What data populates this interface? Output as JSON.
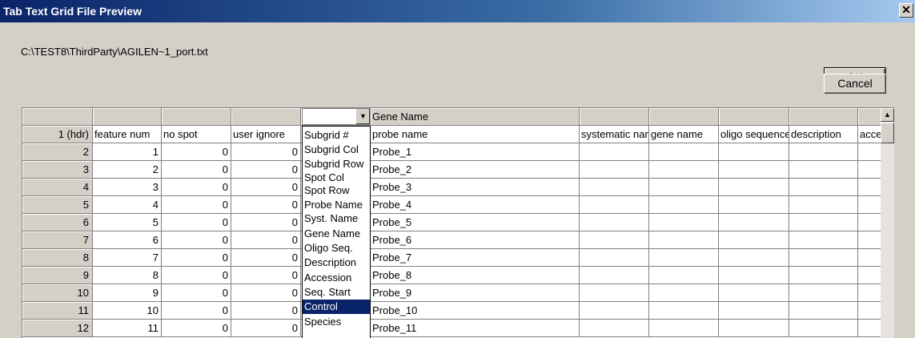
{
  "window": {
    "title": "Tab Text Grid File Preview",
    "close_glyph": "✕"
  },
  "file_path": "C:\\TEST8\\ThirdParty\\AGILEN~1_port.txt",
  "buttons": {
    "ok": "OK",
    "cancel": "Cancel"
  },
  "grid": {
    "mapping_row": [
      "",
      "",
      "",
      "",
      "",
      "Gene Name",
      "",
      "",
      "",
      "",
      ""
    ],
    "header_row": [
      "1 (hdr)",
      "feature num",
      "no spot",
      "user ignore",
      "",
      "probe name",
      "systematic name",
      "gene name",
      "oligo sequence",
      "description",
      "accession"
    ],
    "rows": [
      [
        "2",
        "1",
        "0",
        "0",
        "",
        "Probe_1"
      ],
      [
        "3",
        "2",
        "0",
        "0",
        "",
        "Probe_2"
      ],
      [
        "4",
        "3",
        "0",
        "0",
        "",
        "Probe_3"
      ],
      [
        "5",
        "4",
        "0",
        "0",
        "",
        "Probe_4"
      ],
      [
        "6",
        "5",
        "0",
        "0",
        "",
        "Probe_5"
      ],
      [
        "7",
        "6",
        "0",
        "0",
        "",
        "Probe_6"
      ],
      [
        "8",
        "7",
        "0",
        "0",
        "",
        "Probe_7"
      ],
      [
        "9",
        "8",
        "0",
        "0",
        "",
        "Probe_8"
      ],
      [
        "10",
        "9",
        "0",
        "0",
        "",
        "Probe_9"
      ],
      [
        "11",
        "10",
        "0",
        "0",
        "",
        "Probe_10"
      ],
      [
        "12",
        "11",
        "0",
        "0",
        "",
        "Probe_11"
      ]
    ]
  },
  "dropdown": {
    "value": "",
    "selected": "Control",
    "options": [
      "Subgrid #",
      "Subgrid Col",
      "Subgrid Row",
      "Spot Col",
      "Spot Row",
      "Probe Name",
      "Syst. Name",
      "Gene Name",
      "Oligo Seq.",
      "Description",
      "Accession",
      "Seq. Start",
      "Control",
      "Species"
    ]
  },
  "colors": {
    "title_bar": "#0a246a",
    "selection": "#0a246a",
    "window_bg": "#d4d0c8"
  }
}
